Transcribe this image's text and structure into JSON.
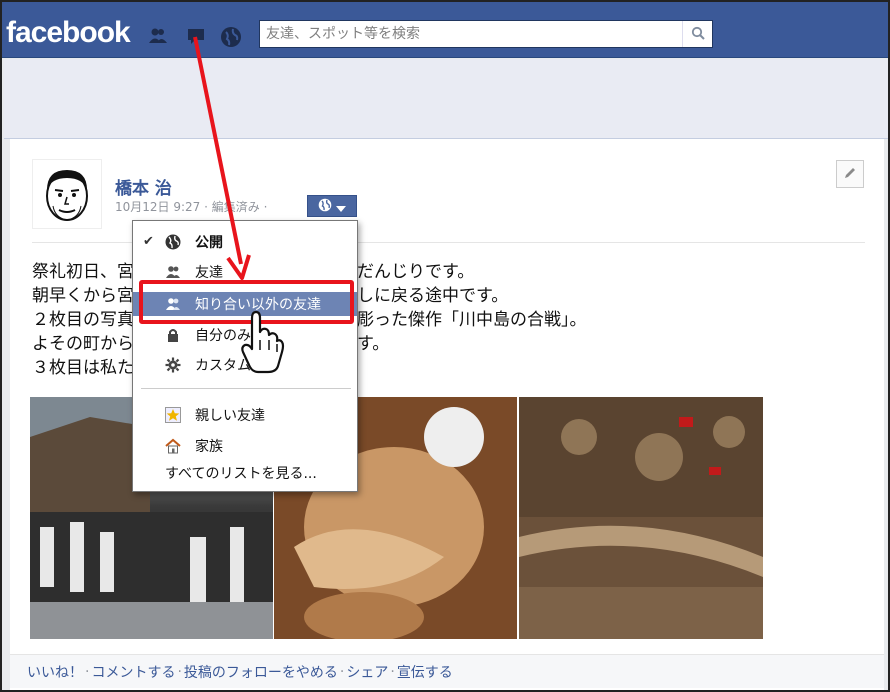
{
  "header": {
    "logo": "facebook",
    "search_placeholder": "友達、スポット等を検索",
    "icons": [
      "friend-requests-icon",
      "messages-icon",
      "notifications-globe-icon",
      "search-icon"
    ]
  },
  "post": {
    "author": "橋本 治",
    "meta_date": "10月12日 9:27",
    "meta_sep": " · ",
    "meta_edited": "編集済み",
    "meta_tail": " ·",
    "text_lines": [
      "祭礼初日、宮",
      "朝早くから宮",
      "２枚目の写真",
      "よその町から",
      "３枚目は私た"
    ],
    "text_right": [
      "だんじりです。",
      "しに戻る途中です。",
      "彫った傑作「川中島の合戦」。",
      "",
      "す。"
    ],
    "actions": [
      "いいね！",
      "コメントする",
      "投稿のフォローをやめる",
      "シェア",
      "宣伝する"
    ]
  },
  "privacy_menu": {
    "items": [
      {
        "label": "公開",
        "icon": "globe-icon",
        "checked": true,
        "bold": true
      },
      {
        "label": "友達",
        "icon": "friends-icon"
      },
      {
        "label": "知り合い以外の友達",
        "icon": "friends-except-acquaintances-icon",
        "highlighted": true
      },
      {
        "label": "自分のみ",
        "icon": "lock-icon"
      },
      {
        "label": "カスタム",
        "icon": "gear-icon"
      }
    ],
    "lists": [
      {
        "label": "親しい友達",
        "icon": "star-icon"
      },
      {
        "label": "家族",
        "icon": "house-icon"
      }
    ],
    "see_all": "すべてのリストを見る..."
  },
  "colors": {
    "brand_blue": "#3b5998",
    "highlight": "#6d84b4",
    "annotation_red": "#e8141c"
  }
}
